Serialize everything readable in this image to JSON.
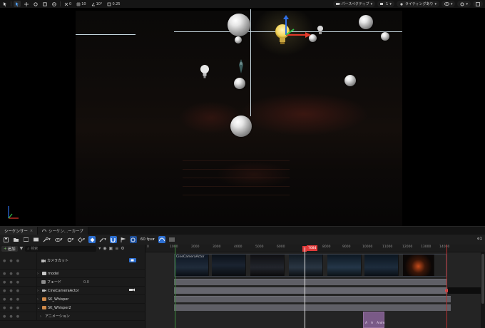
{
  "viewport_toolbar": {
    "snap_value": "0",
    "grid_value": "10",
    "rotation_value": "10°",
    "scale_value": "0.25",
    "perspective_label": "パースペクティブ",
    "camera_speed": "1",
    "lighting_label": "ライティングあり"
  },
  "sequencer_tabs": [
    {
      "label": "シーケンサー"
    },
    {
      "label": "シーケン...ーカーブ"
    }
  ],
  "sequencer_toolbar": {
    "fps_label": "60 fps",
    "right_label": "e1"
  },
  "tree": {
    "add_label": "追加",
    "search_placeholder": "検索",
    "rows": [
      {
        "name": "カメラカット",
        "value": ""
      },
      {
        "name": "model",
        "value": ""
      },
      {
        "name": "フェード",
        "value": "0.0"
      },
      {
        "name": "CineCameraActor",
        "value": ""
      },
      {
        "name": "SK_Whisper",
        "value": ""
      },
      {
        "name": "SK_Whisper2",
        "value": ""
      },
      {
        "name": "アニメーション",
        "value": ""
      }
    ]
  },
  "timeline": {
    "playhead_frame": "7084",
    "ruler_ticks": [
      "0",
      "1000",
      "2000",
      "3000",
      "4000",
      "5000",
      "6000",
      "7000",
      "8000",
      "9000",
      "10000",
      "11000",
      "12000",
      "13000",
      "14000"
    ],
    "camera_cut_label": "CineCameraActor",
    "anim_section_labels": [
      "A",
      "A",
      "Anim"
    ]
  },
  "colors": {
    "accent_blue": "#2d6fd1",
    "playhead_red": "#e23a3a",
    "section_purple": "#7a5a87"
  }
}
